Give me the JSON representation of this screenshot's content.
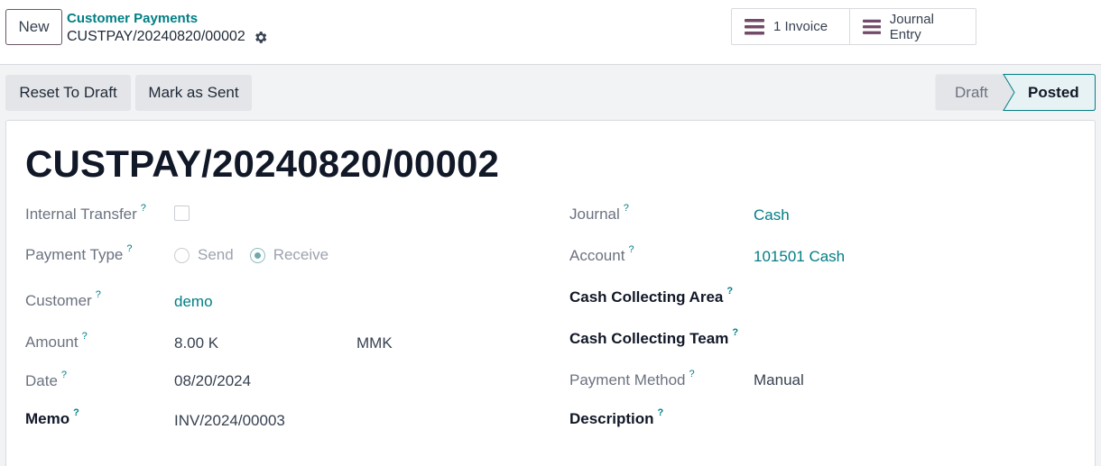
{
  "top": {
    "new_label": "New",
    "breadcrumb": "Customer Payments",
    "record_name": "CUSTPAY/20240820/00002",
    "smart_buttons": [
      {
        "label": "1 Invoice",
        "icon": "list-icon"
      },
      {
        "label": "Journal Entry",
        "icon": "list-icon"
      }
    ]
  },
  "actions": {
    "reset_label": "Reset To Draft",
    "mark_sent_label": "Mark as Sent"
  },
  "status": {
    "stages": [
      "Draft",
      "Posted"
    ],
    "current": "Posted"
  },
  "form": {
    "title": "CUSTPAY/20240820/00002",
    "help_mark": "?",
    "left": {
      "internal_transfer_label": "Internal Transfer",
      "internal_transfer_checked": false,
      "payment_type_label": "Payment Type",
      "payment_type_options": [
        "Send",
        "Receive"
      ],
      "payment_type_selected": "Receive",
      "customer_label": "Customer",
      "customer_value": "demo",
      "amount_label": "Amount",
      "amount_value": "8.00 K",
      "currency_value": "MMK",
      "date_label": "Date",
      "date_value": "08/20/2024",
      "memo_label": "Memo",
      "memo_value": "INV/2024/00003"
    },
    "right": {
      "journal_label": "Journal",
      "journal_value": "Cash",
      "account_label": "Account",
      "account_value": "101501 Cash",
      "cash_area_label": "Cash Collecting Area",
      "cash_team_label": "Cash Collecting Team",
      "payment_method_label": "Payment Method",
      "payment_method_value": "Manual",
      "description_label": "Description"
    }
  },
  "colors": {
    "accent": "#017e84",
    "brand": "#714b67",
    "button_bg": "#e3e5e8"
  }
}
